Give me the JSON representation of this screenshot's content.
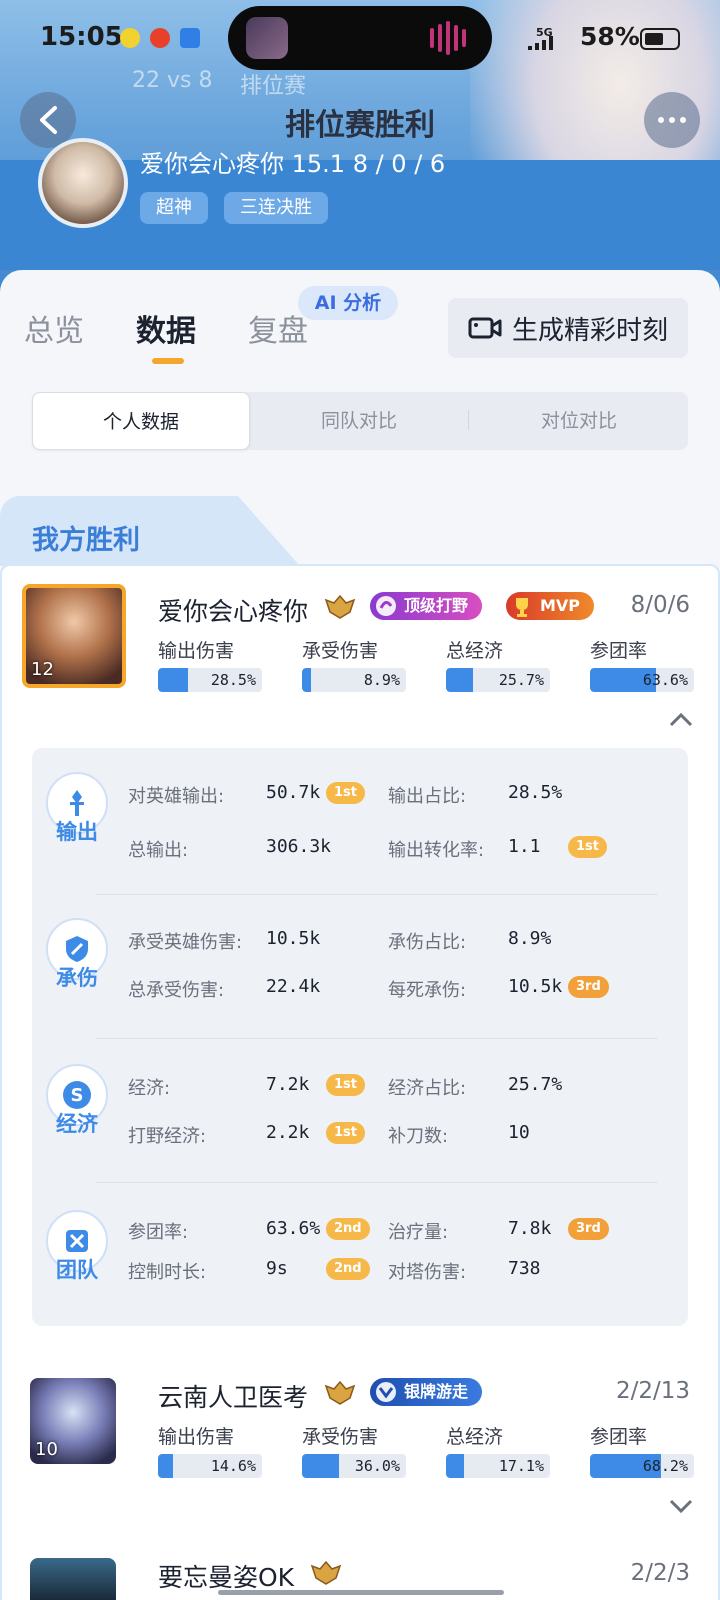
{
  "status_bar": {
    "time": "15:05",
    "network": "5G",
    "battery": "58%"
  },
  "header": {
    "faded_subtitle_left": "22 vs 8",
    "faded_subtitle_right": "排位赛",
    "title": "排位赛胜利",
    "player_line": "爱你会心疼你   15.1    8 / 0 / 6",
    "tags": [
      "超神",
      "三连决胜"
    ]
  },
  "tabs": [
    {
      "label": "总览"
    },
    {
      "label": "数据"
    },
    {
      "label": "复盘"
    }
  ],
  "ai_chip": "AI 分析",
  "generate_button": "生成精彩时刻",
  "segments": [
    "个人数据",
    "同队对比",
    "对位对比"
  ],
  "section_title": "我方胜利",
  "metric_labels": [
    "输出伤害",
    "承受伤害",
    "总经济",
    "参团率"
  ],
  "players": [
    {
      "name": "爱你会心疼你",
      "level": "12",
      "kda": "8/0/6",
      "badges": [
        "顶级打野",
        "MVP"
      ],
      "metrics": [
        {
          "label": "输出伤害",
          "value": "28.5%",
          "pct": 28.5
        },
        {
          "label": "承受伤害",
          "value": "8.9%",
          "pct": 8.9
        },
        {
          "label": "总经济",
          "value": "25.7%",
          "pct": 25.7
        },
        {
          "label": "参团率",
          "value": "63.6%",
          "pct": 63.6
        }
      ]
    },
    {
      "name": "云南人卫医考",
      "level": "10",
      "kda": "2/2/13",
      "badges": [
        "银牌游走"
      ],
      "metrics": [
        {
          "label": "输出伤害",
          "value": "14.6%",
          "pct": 14.6
        },
        {
          "label": "承受伤害",
          "value": "36.0%",
          "pct": 36.0
        },
        {
          "label": "总经济",
          "value": "17.1%",
          "pct": 17.1
        },
        {
          "label": "参团率",
          "value": "68.2%",
          "pct": 68.2
        }
      ]
    },
    {
      "name": "要忘曼姿OK",
      "kda": "2/2/3"
    }
  ],
  "detail_groups": [
    {
      "category": "输出",
      "rows": [
        [
          {
            "label": "对英雄输出:",
            "value": "50.7k",
            "rank": "1st"
          },
          {
            "label": "输出占比:",
            "value": "28.5%",
            "rank": ""
          }
        ],
        [
          {
            "label": "总输出:",
            "value": "306.3k",
            "rank": ""
          },
          {
            "label": "输出转化率:",
            "value": "1.1",
            "rank": "1st"
          }
        ]
      ]
    },
    {
      "category": "承伤",
      "rows": [
        [
          {
            "label": "承受英雄伤害:",
            "value": "10.5k",
            "rank": ""
          },
          {
            "label": "承伤占比:",
            "value": "8.9%",
            "rank": ""
          }
        ],
        [
          {
            "label": "总承受伤害:",
            "value": "22.4k",
            "rank": ""
          },
          {
            "label": "每死承伤:",
            "value": "10.5k",
            "rank": "3rd"
          }
        ]
      ]
    },
    {
      "category": "经济",
      "rows": [
        [
          {
            "label": "经济:",
            "value": "7.2k",
            "rank": "1st"
          },
          {
            "label": "经济占比:",
            "value": "25.7%",
            "rank": ""
          }
        ],
        [
          {
            "label": "打野经济:",
            "value": "2.2k",
            "rank": "1st"
          },
          {
            "label": "补刀数:",
            "value": "10",
            "rank": ""
          }
        ]
      ]
    },
    {
      "category": "团队",
      "rows": [
        [
          {
            "label": "参团率:",
            "value": "63.6%",
            "rank": "2nd"
          },
          {
            "label": "治疗量:",
            "value": "7.8k",
            "rank": "3rd"
          }
        ],
        [
          {
            "label": "控制时长:",
            "value": "9s",
            "rank": "2nd"
          },
          {
            "label": "对塔伤害:",
            "value": "738",
            "rank": ""
          }
        ]
      ]
    }
  ],
  "colors": {
    "accent": "#3d8be6",
    "tab_underline": "#f6a62a",
    "rank_badge": "#f7b84a",
    "header_blue": "#3a86d2"
  }
}
